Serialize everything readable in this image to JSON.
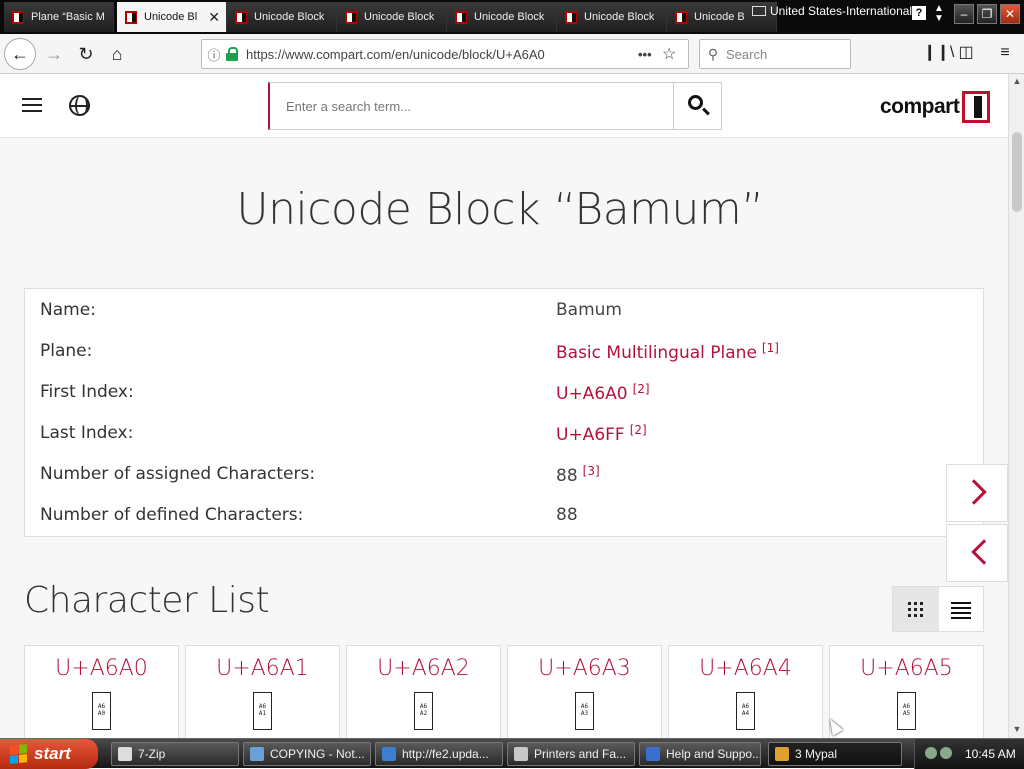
{
  "browser": {
    "tabs": [
      {
        "label": "Plane “Basic M",
        "active": false
      },
      {
        "label": "Unicode Bl",
        "active": true
      },
      {
        "label": "Unicode Block",
        "active": false
      },
      {
        "label": "Unicode Block",
        "active": false
      },
      {
        "label": "Unicode Block",
        "active": false
      },
      {
        "label": "Unicode Block",
        "active": false
      },
      {
        "label": "Unicode B",
        "active": false
      }
    ],
    "keyboard_layout": "United States-International",
    "url": "https://www.compart.com/en/unicode/block/U+A6A0",
    "search_placeholder": "Search"
  },
  "site": {
    "search_placeholder": "Enter a search term...",
    "logo_text": "compart",
    "accent_color": "#b3123a"
  },
  "page": {
    "title": "Unicode Block “Bamum”",
    "info": [
      {
        "label": "Name:",
        "value": "Bamum",
        "link": false,
        "note": ""
      },
      {
        "label": "Plane:",
        "value": "Basic Multilingual Plane",
        "link": true,
        "note": "[1]"
      },
      {
        "label": "First Index:",
        "value": "U+A6A0",
        "link": true,
        "note": "[2]"
      },
      {
        "label": "Last Index:",
        "value": "U+A6FF",
        "link": true,
        "note": "[2]"
      },
      {
        "label": "Number of assigned Characters:",
        "value": "88",
        "link": false,
        "note": "[3]"
      },
      {
        "label": "Number of defined Characters:",
        "value": "88",
        "link": false,
        "note": ""
      }
    ],
    "character_list_title": "Character List",
    "characters": [
      {
        "code": "U+A6A0",
        "glyph_top": "A6",
        "glyph_bottom": "A0"
      },
      {
        "code": "U+A6A1",
        "glyph_top": "A6",
        "glyph_bottom": "A1"
      },
      {
        "code": "U+A6A2",
        "glyph_top": "A6",
        "glyph_bottom": "A2"
      },
      {
        "code": "U+A6A3",
        "glyph_top": "A6",
        "glyph_bottom": "A3"
      },
      {
        "code": "U+A6A4",
        "glyph_top": "A6",
        "glyph_bottom": "A4"
      },
      {
        "code": "U+A6A5",
        "glyph_top": "A6",
        "glyph_bottom": "A5"
      }
    ]
  },
  "taskbar": {
    "start_label": "start",
    "tasks": [
      {
        "label": "7-Zip",
        "icon_color": "#dddddd",
        "active": false
      },
      {
        "label": "COPYING - Not...",
        "icon_color": "#6aa0d8",
        "active": false
      },
      {
        "label": "http://fe2.upda...",
        "icon_color": "#3a7fd0",
        "active": false
      },
      {
        "label": "Printers and Fa...",
        "icon_color": "#c8c8c8",
        "active": false
      },
      {
        "label": "Help and Suppo...",
        "icon_color": "#3a6fd0",
        "active": false
      },
      {
        "label": "3 Mypal",
        "icon_color": "#e0a030",
        "active": true
      }
    ],
    "clock": "10:45 AM"
  }
}
